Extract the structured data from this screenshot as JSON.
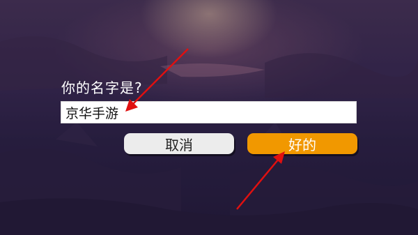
{
  "dialog": {
    "prompt": "你的名字是?",
    "name_value": "京华手游",
    "cancel_label": "取消",
    "ok_label": "好的"
  },
  "colors": {
    "ok_button": "#f19800",
    "cancel_button": "#ececec",
    "annotation_arrow": "#e01010"
  },
  "icons": {
    "annotation_arrow_1": "arrow-icon",
    "annotation_arrow_2": "arrow-icon"
  }
}
